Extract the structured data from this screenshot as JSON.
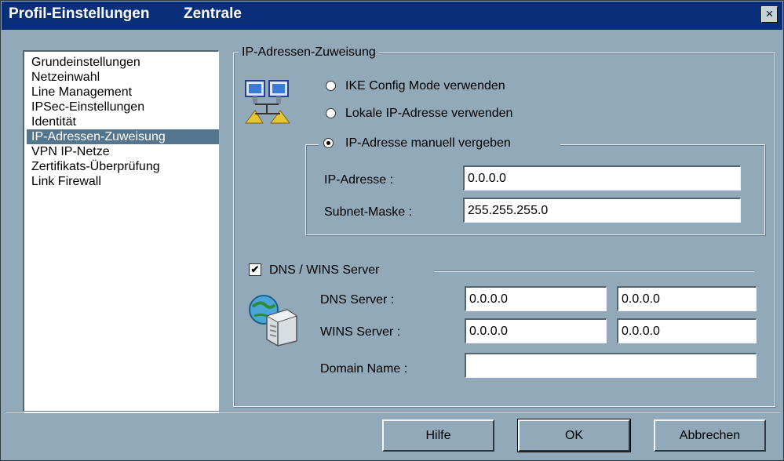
{
  "titlebar": {
    "title": "Profil-Einstellungen",
    "subtitle": "Zentrale",
    "close": "×"
  },
  "nav": {
    "items": [
      {
        "label": "Grundeinstellungen"
      },
      {
        "label": "Netzeinwahl"
      },
      {
        "label": "Line Management"
      },
      {
        "label": "IPSec-Einstellungen"
      },
      {
        "label": "Identität"
      },
      {
        "label": "IP-Adressen-Zuweisung"
      },
      {
        "label": "VPN IP-Netze"
      },
      {
        "label": "Zertifikats-Überprüfung"
      },
      {
        "label": "Link Firewall"
      }
    ],
    "selected_index": 5
  },
  "ip_assignment": {
    "group_label": "IP-Adressen-Zuweisung",
    "option_ike": "IKE Config Mode verwenden",
    "option_local": "Lokale IP-Adresse verwenden",
    "option_manual": "IP-Adresse manuell vergeben",
    "selected_option": "manual",
    "ip_label": "IP-Adresse :",
    "ip_value": "0.0.0.0",
    "subnet_label": "Subnet-Maske :",
    "subnet_value": "255.255.255.0"
  },
  "dns": {
    "checkbox_label": "DNS / WINS Server",
    "checked": true,
    "dns_label": "DNS Server :",
    "dns_primary": "0.0.0.0",
    "dns_secondary": "0.0.0.0",
    "wins_label": "WINS Server :",
    "wins_primary": "0.0.0.0",
    "wins_secondary": "0.0.0.0",
    "domain_label": "Domain Name :",
    "domain_value": ""
  },
  "buttons": {
    "help": "Hilfe",
    "ok": "OK",
    "cancel": "Abbrechen"
  },
  "colors": {
    "dialog_bg": "#92A9B9",
    "titlebar": "#0a2f7a",
    "selection": "#53758d"
  },
  "icons": {
    "network": "network-computers-icon",
    "server": "dns-server-icon",
    "close": "close-icon"
  }
}
